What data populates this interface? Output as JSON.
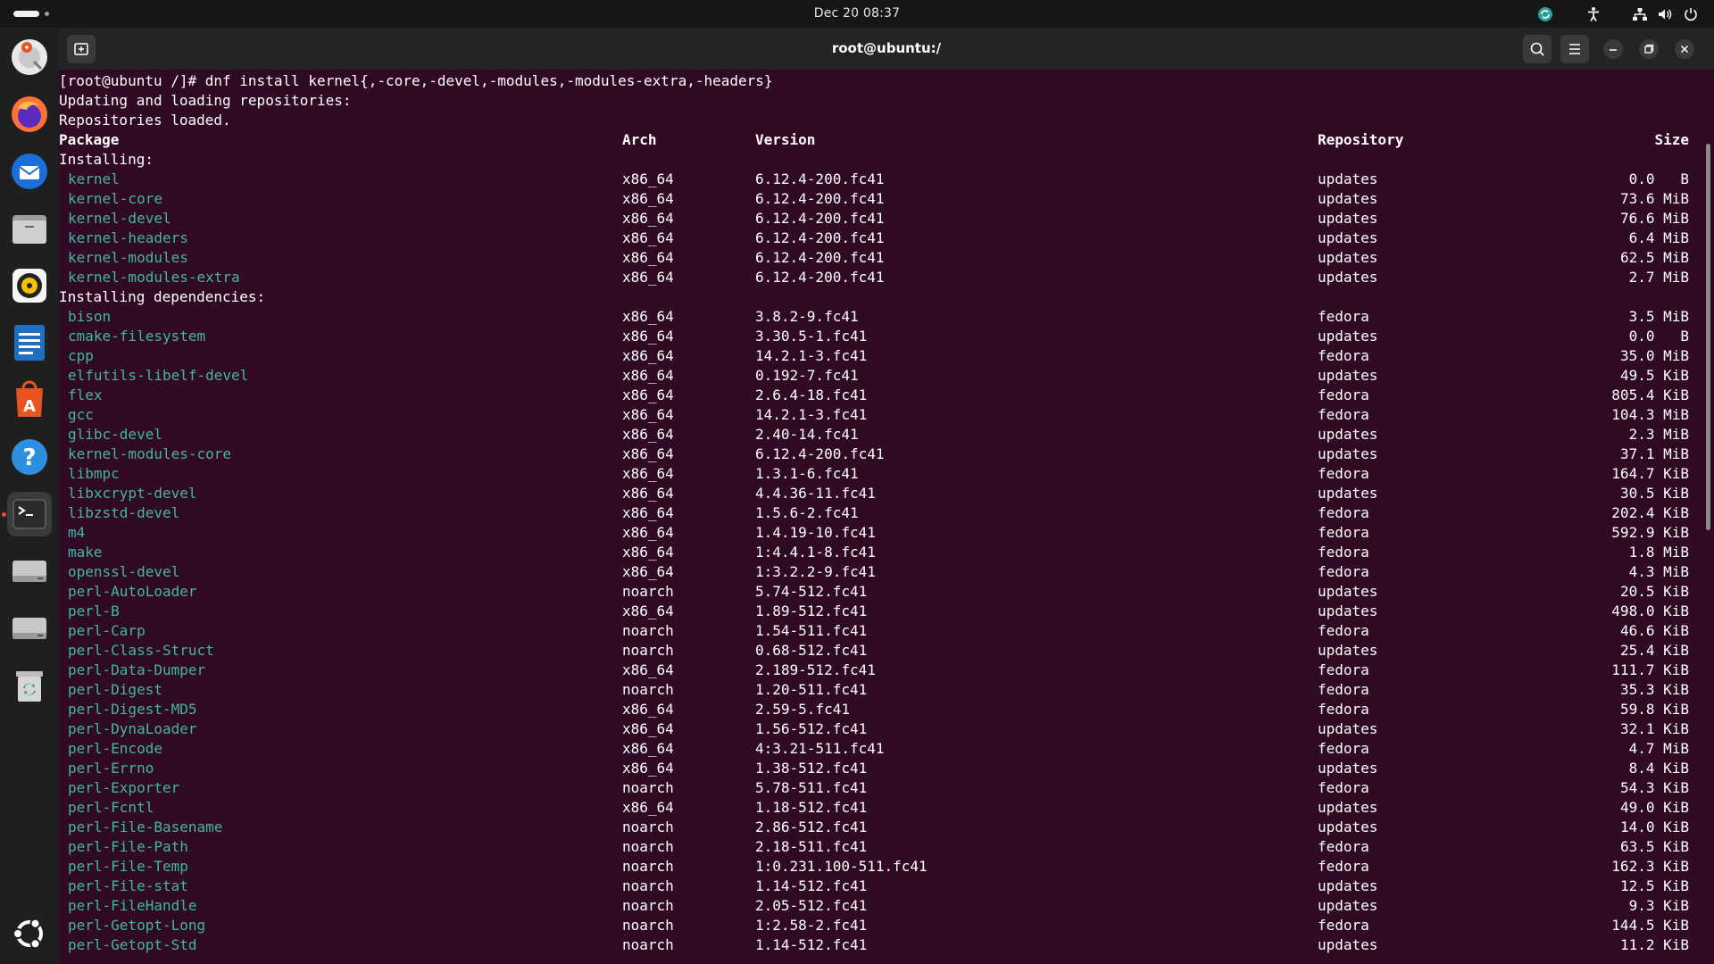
{
  "topbar": {
    "clock": "Dec 20  08:37"
  },
  "dock": {
    "icons": [
      "help-icon",
      "firefox-icon",
      "thunderbird-icon",
      "files-icon",
      "rhythmbox-icon",
      "writer-icon",
      "app-center-icon",
      "help-icon",
      "terminal-icon",
      "drive-icon",
      "drive-icon",
      "trash-icon",
      "ubuntu-logo-icon"
    ]
  },
  "window": {
    "title": "root@ubuntu:/"
  },
  "terminal": {
    "command_line": "[root@ubuntu /]# dnf install kernel{,-core,-devel,-modules,-modules-extra,-headers}",
    "status1": "Updating and loading repositories:",
    "status2": "Repositories loaded.",
    "headers": {
      "package": "Package",
      "arch": "Arch",
      "version": "Version",
      "repository": "Repository",
      "size": "Size"
    },
    "section_installing": "Installing:",
    "section_deps": "Installing dependencies:",
    "installing": [
      {
        "pkg": "kernel",
        "arch": "x86_64",
        "ver": "6.12.4-200.fc41",
        "repo": "updates",
        "size": "0.0   B"
      },
      {
        "pkg": "kernel-core",
        "arch": "x86_64",
        "ver": "6.12.4-200.fc41",
        "repo": "updates",
        "size": "73.6 MiB"
      },
      {
        "pkg": "kernel-devel",
        "arch": "x86_64",
        "ver": "6.12.4-200.fc41",
        "repo": "updates",
        "size": "76.6 MiB"
      },
      {
        "pkg": "kernel-headers",
        "arch": "x86_64",
        "ver": "6.12.4-200.fc41",
        "repo": "updates",
        "size": "6.4 MiB"
      },
      {
        "pkg": "kernel-modules",
        "arch": "x86_64",
        "ver": "6.12.4-200.fc41",
        "repo": "updates",
        "size": "62.5 MiB"
      },
      {
        "pkg": "kernel-modules-extra",
        "arch": "x86_64",
        "ver": "6.12.4-200.fc41",
        "repo": "updates",
        "size": "2.7 MiB"
      }
    ],
    "dependencies": [
      {
        "pkg": "bison",
        "arch": "x86_64",
        "ver": "3.8.2-9.fc41",
        "repo": "fedora",
        "size": "3.5 MiB"
      },
      {
        "pkg": "cmake-filesystem",
        "arch": "x86_64",
        "ver": "3.30.5-1.fc41",
        "repo": "updates",
        "size": "0.0   B"
      },
      {
        "pkg": "cpp",
        "arch": "x86_64",
        "ver": "14.2.1-3.fc41",
        "repo": "fedora",
        "size": "35.0 MiB"
      },
      {
        "pkg": "elfutils-libelf-devel",
        "arch": "x86_64",
        "ver": "0.192-7.fc41",
        "repo": "updates",
        "size": "49.5 KiB"
      },
      {
        "pkg": "flex",
        "arch": "x86_64",
        "ver": "2.6.4-18.fc41",
        "repo": "fedora",
        "size": "805.4 KiB"
      },
      {
        "pkg": "gcc",
        "arch": "x86_64",
        "ver": "14.2.1-3.fc41",
        "repo": "fedora",
        "size": "104.3 MiB"
      },
      {
        "pkg": "glibc-devel",
        "arch": "x86_64",
        "ver": "2.40-14.fc41",
        "repo": "updates",
        "size": "2.3 MiB"
      },
      {
        "pkg": "kernel-modules-core",
        "arch": "x86_64",
        "ver": "6.12.4-200.fc41",
        "repo": "updates",
        "size": "37.1 MiB"
      },
      {
        "pkg": "libmpc",
        "arch": "x86_64",
        "ver": "1.3.1-6.fc41",
        "repo": "fedora",
        "size": "164.7 KiB"
      },
      {
        "pkg": "libxcrypt-devel",
        "arch": "x86_64",
        "ver": "4.4.36-11.fc41",
        "repo": "updates",
        "size": "30.5 KiB"
      },
      {
        "pkg": "libzstd-devel",
        "arch": "x86_64",
        "ver": "1.5.6-2.fc41",
        "repo": "fedora",
        "size": "202.4 KiB"
      },
      {
        "pkg": "m4",
        "arch": "x86_64",
        "ver": "1.4.19-10.fc41",
        "repo": "fedora",
        "size": "592.9 KiB"
      },
      {
        "pkg": "make",
        "arch": "x86_64",
        "ver": "1:4.4.1-8.fc41",
        "repo": "fedora",
        "size": "1.8 MiB"
      },
      {
        "pkg": "openssl-devel",
        "arch": "x86_64",
        "ver": "1:3.2.2-9.fc41",
        "repo": "fedora",
        "size": "4.3 MiB"
      },
      {
        "pkg": "perl-AutoLoader",
        "arch": "noarch",
        "ver": "5.74-512.fc41",
        "repo": "updates",
        "size": "20.5 KiB"
      },
      {
        "pkg": "perl-B",
        "arch": "x86_64",
        "ver": "1.89-512.fc41",
        "repo": "updates",
        "size": "498.0 KiB"
      },
      {
        "pkg": "perl-Carp",
        "arch": "noarch",
        "ver": "1.54-511.fc41",
        "repo": "fedora",
        "size": "46.6 KiB"
      },
      {
        "pkg": "perl-Class-Struct",
        "arch": "noarch",
        "ver": "0.68-512.fc41",
        "repo": "updates",
        "size": "25.4 KiB"
      },
      {
        "pkg": "perl-Data-Dumper",
        "arch": "x86_64",
        "ver": "2.189-512.fc41",
        "repo": "fedora",
        "size": "111.7 KiB"
      },
      {
        "pkg": "perl-Digest",
        "arch": "noarch",
        "ver": "1.20-511.fc41",
        "repo": "fedora",
        "size": "35.3 KiB"
      },
      {
        "pkg": "perl-Digest-MD5",
        "arch": "x86_64",
        "ver": "2.59-5.fc41",
        "repo": "fedora",
        "size": "59.8 KiB"
      },
      {
        "pkg": "perl-DynaLoader",
        "arch": "x86_64",
        "ver": "1.56-512.fc41",
        "repo": "updates",
        "size": "32.1 KiB"
      },
      {
        "pkg": "perl-Encode",
        "arch": "x86_64",
        "ver": "4:3.21-511.fc41",
        "repo": "fedora",
        "size": "4.7 MiB"
      },
      {
        "pkg": "perl-Errno",
        "arch": "x86_64",
        "ver": "1.38-512.fc41",
        "repo": "updates",
        "size": "8.4 KiB"
      },
      {
        "pkg": "perl-Exporter",
        "arch": "noarch",
        "ver": "5.78-511.fc41",
        "repo": "fedora",
        "size": "54.3 KiB"
      },
      {
        "pkg": "perl-Fcntl",
        "arch": "x86_64",
        "ver": "1.18-512.fc41",
        "repo": "updates",
        "size": "49.0 KiB"
      },
      {
        "pkg": "perl-File-Basename",
        "arch": "noarch",
        "ver": "2.86-512.fc41",
        "repo": "updates",
        "size": "14.0 KiB"
      },
      {
        "pkg": "perl-File-Path",
        "arch": "noarch",
        "ver": "2.18-511.fc41",
        "repo": "fedora",
        "size": "63.5 KiB"
      },
      {
        "pkg": "perl-File-Temp",
        "arch": "noarch",
        "ver": "1:0.231.100-511.fc41",
        "repo": "fedora",
        "size": "162.3 KiB"
      },
      {
        "pkg": "perl-File-stat",
        "arch": "noarch",
        "ver": "1.14-512.fc41",
        "repo": "updates",
        "size": "12.5 KiB"
      },
      {
        "pkg": "perl-FileHandle",
        "arch": "noarch",
        "ver": "2.05-512.fc41",
        "repo": "updates",
        "size": "9.3 KiB"
      },
      {
        "pkg": "perl-Getopt-Long",
        "arch": "noarch",
        "ver": "1:2.58-2.fc41",
        "repo": "fedora",
        "size": "144.5 KiB"
      },
      {
        "pkg": "perl-Getopt-Std",
        "arch": "noarch",
        "ver": "1.14-512.fc41",
        "repo": "updates",
        "size": "11.2 KiB"
      }
    ]
  }
}
